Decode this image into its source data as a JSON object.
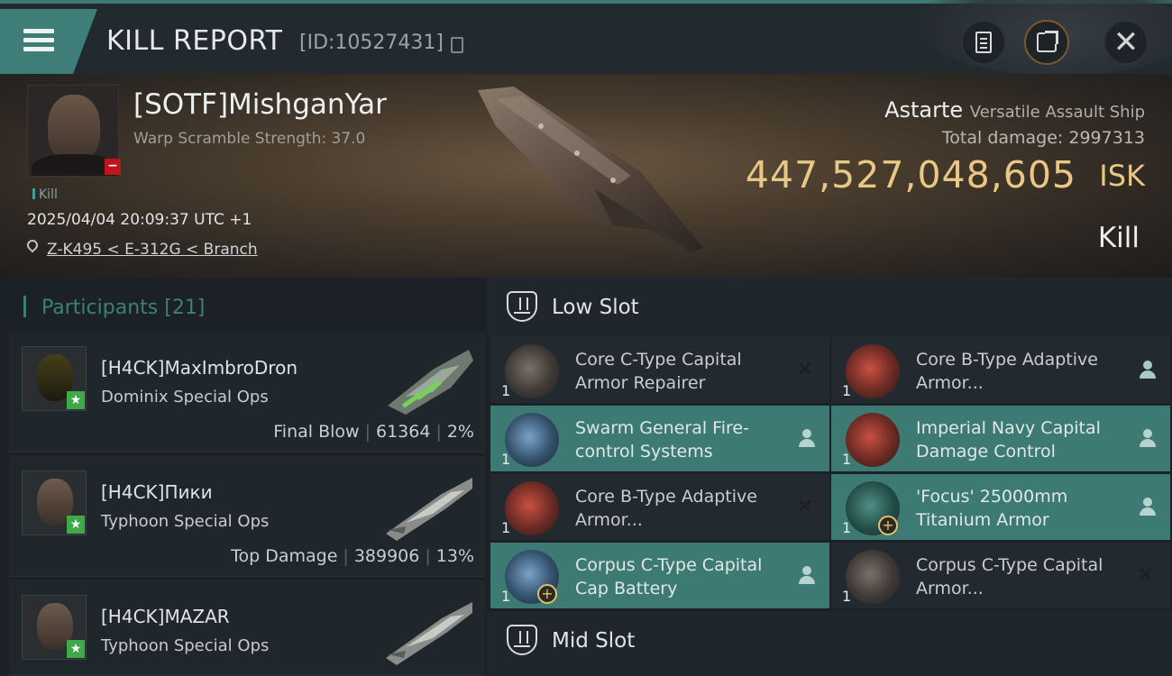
{
  "header": {
    "title": "KILL REPORT",
    "kill_id": "[ID:10527431]"
  },
  "victim": {
    "name": "[SOTF]MishganYar",
    "warp_scramble": "Warp Scramble Strength: 37.0",
    "tag": "Kill",
    "time": "2025/04/04 20:09:37 UTC +1",
    "location": "Z-K495 < E-312G < Branch",
    "ship_name": "Astarte",
    "ship_class": "Versatile Assault Ship",
    "total_damage_label": "Total damage:",
    "total_damage": "2997313",
    "isk_value": "447,527,048,605",
    "isk_unit": "ISK",
    "result": "Kill"
  },
  "participants": {
    "label": "Participants",
    "count": "[21]",
    "rows": [
      {
        "name": "[H4CK]MaxImbroDron",
        "ship": "Dominix Special Ops",
        "role": "Final Blow",
        "damage": "61364",
        "percent": "2%"
      },
      {
        "name": "[H4CK]Пики",
        "ship": "Typhoon Special Ops",
        "role": "Top Damage",
        "damage": "389906",
        "percent": "13%"
      },
      {
        "name": "[H4CK]MAZAR",
        "ship": "Typhoon Special Ops"
      }
    ]
  },
  "slots": {
    "low_slot_title": "Low Slot",
    "mid_slot_title": "Mid Slot",
    "low_items": [
      {
        "qty": "1",
        "name": "Core C-Type Capital Armor Repairer",
        "state": "destroyed"
      },
      {
        "qty": "1",
        "name": "Core B-Type Adaptive Armor...",
        "state": "dropped"
      },
      {
        "qty": "1",
        "name": "Swarm General Fire-control Systems",
        "state": "dropped"
      },
      {
        "qty": "1",
        "name": "Imperial Navy Capital Damage Control",
        "state": "dropped"
      },
      {
        "qty": "1",
        "name": "Core B-Type Adaptive Armor...",
        "state": "destroyed"
      },
      {
        "qty": "1",
        "name": "'Focus' 25000mm Titanium Armor",
        "state": "dropped"
      },
      {
        "qty": "1",
        "name": "Corpus C-Type Capital Cap Battery",
        "state": "dropped"
      },
      {
        "qty": "1",
        "name": "Corpus C-Type Capital Armor...",
        "state": "destroyed"
      }
    ]
  },
  "icons": {
    "destroyed": "close-icon",
    "dropped": "person-icon"
  }
}
